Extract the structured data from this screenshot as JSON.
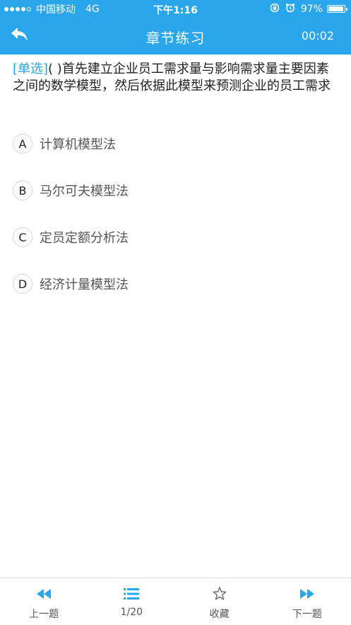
{
  "status_bar": {
    "carrier": "中国移动",
    "network": "4G",
    "time": "下午1:16",
    "battery": "97%",
    "battery_level": 0.97,
    "icons": [
      "orientation-lock-icon",
      "alarm-icon",
      "battery-icon"
    ]
  },
  "nav": {
    "title": "章节练习",
    "timer": "00:02",
    "back_icon": "back-arrow-icon"
  },
  "question": {
    "type_label": "[单选]",
    "text": "(   )首先建立企业员工需求量与影响需求量主要因素之间的数学模型，然后依据此模型来预测企业的员工需求"
  },
  "options": [
    {
      "letter": "A",
      "text": "计算机模型法"
    },
    {
      "letter": "B",
      "text": "马尔可夫模型法"
    },
    {
      "letter": "C",
      "text": "定员定额分析法"
    },
    {
      "letter": "D",
      "text": "经济计量模型法"
    }
  ],
  "bottom_bar": {
    "prev_label": "上一题",
    "list_label": "1/20",
    "favorite_label": "收藏",
    "next_label": "下一题"
  },
  "colors": {
    "accent": "#2aa7ec",
    "text": "#222222",
    "option_text": "#555555"
  }
}
